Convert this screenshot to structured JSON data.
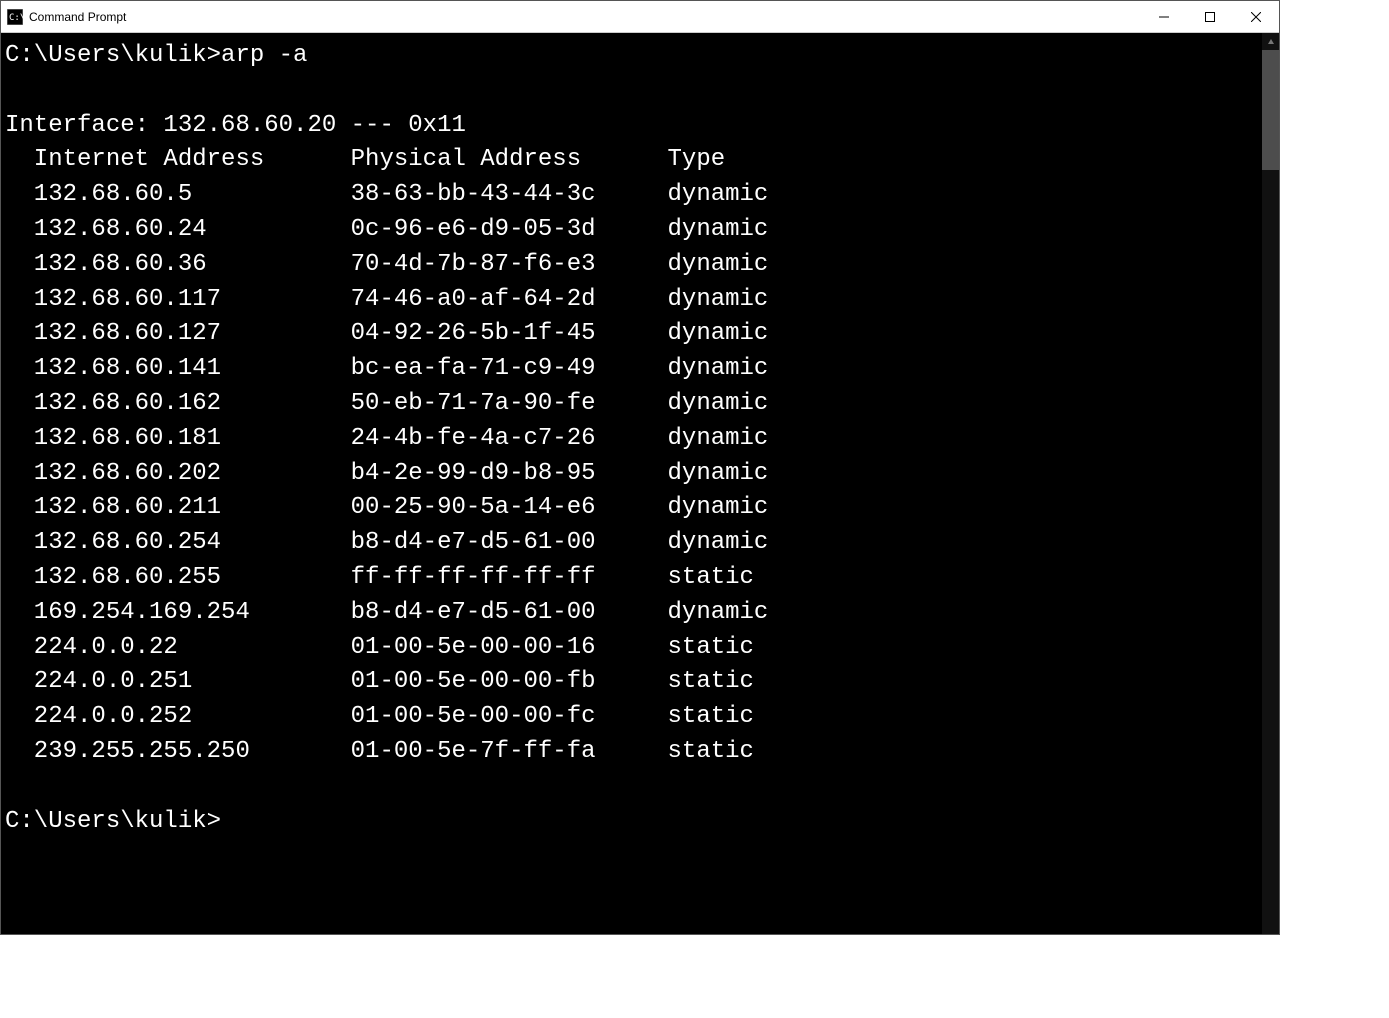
{
  "window": {
    "title": "Command Prompt"
  },
  "terminal": {
    "prompt_line": "C:\\Users\\kulik>arp -a",
    "interface_line": "Interface: 132.68.60.20 --- 0x11",
    "headers": {
      "ip": "Internet Address",
      "mac": "Physical Address",
      "type": "Type"
    },
    "entries": [
      {
        "ip": "132.68.60.5",
        "mac": "38-63-bb-43-44-3c",
        "type": "dynamic"
      },
      {
        "ip": "132.68.60.24",
        "mac": "0c-96-e6-d9-05-3d",
        "type": "dynamic"
      },
      {
        "ip": "132.68.60.36",
        "mac": "70-4d-7b-87-f6-e3",
        "type": "dynamic"
      },
      {
        "ip": "132.68.60.117",
        "mac": "74-46-a0-af-64-2d",
        "type": "dynamic"
      },
      {
        "ip": "132.68.60.127",
        "mac": "04-92-26-5b-1f-45",
        "type": "dynamic"
      },
      {
        "ip": "132.68.60.141",
        "mac": "bc-ea-fa-71-c9-49",
        "type": "dynamic"
      },
      {
        "ip": "132.68.60.162",
        "mac": "50-eb-71-7a-90-fe",
        "type": "dynamic"
      },
      {
        "ip": "132.68.60.181",
        "mac": "24-4b-fe-4a-c7-26",
        "type": "dynamic"
      },
      {
        "ip": "132.68.60.202",
        "mac": "b4-2e-99-d9-b8-95",
        "type": "dynamic"
      },
      {
        "ip": "132.68.60.211",
        "mac": "00-25-90-5a-14-e6",
        "type": "dynamic"
      },
      {
        "ip": "132.68.60.254",
        "mac": "b8-d4-e7-d5-61-00",
        "type": "dynamic"
      },
      {
        "ip": "132.68.60.255",
        "mac": "ff-ff-ff-ff-ff-ff",
        "type": "static"
      },
      {
        "ip": "169.254.169.254",
        "mac": "b8-d4-e7-d5-61-00",
        "type": "dynamic"
      },
      {
        "ip": "224.0.0.22",
        "mac": "01-00-5e-00-00-16",
        "type": "static"
      },
      {
        "ip": "224.0.0.251",
        "mac": "01-00-5e-00-00-fb",
        "type": "static"
      },
      {
        "ip": "224.0.0.252",
        "mac": "01-00-5e-00-00-fc",
        "type": "static"
      },
      {
        "ip": "239.255.255.250",
        "mac": "01-00-5e-7f-ff-fa",
        "type": "static"
      }
    ],
    "final_prompt": "C:\\Users\\kulik>"
  }
}
